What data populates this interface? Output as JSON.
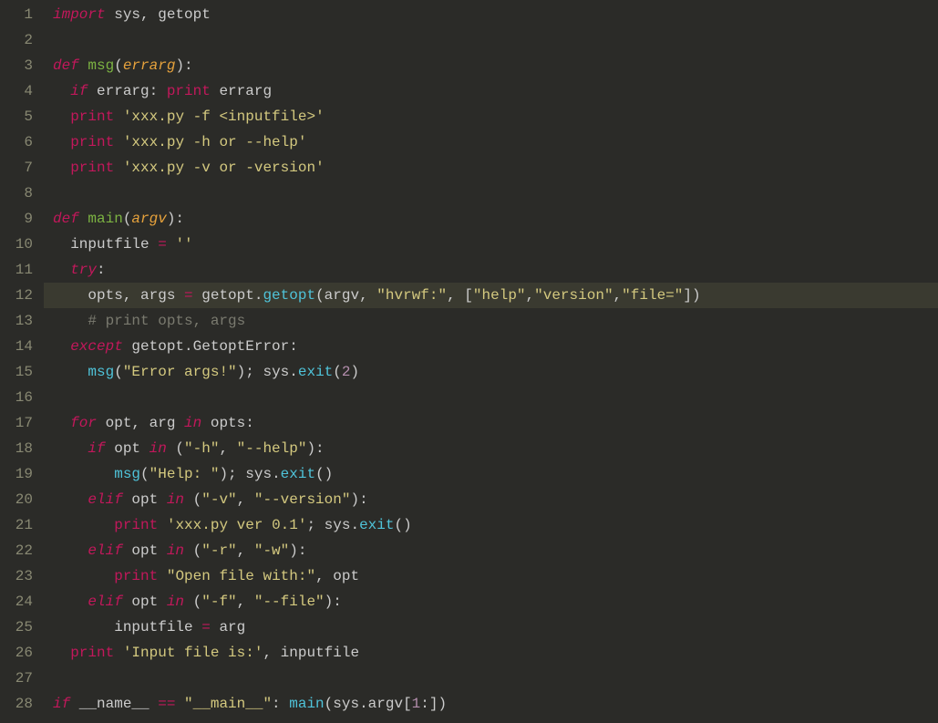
{
  "lines": [
    {
      "n": 1,
      "hl": false,
      "tokens": [
        [
          "kw",
          "import"
        ],
        [
          "pun",
          " sys"
        ],
        [
          "pun",
          ", getopt"
        ]
      ]
    },
    {
      "n": 2,
      "hl": false,
      "tokens": []
    },
    {
      "n": 3,
      "hl": false,
      "tokens": [
        [
          "kw",
          "def "
        ],
        [
          "fn",
          "msg"
        ],
        [
          "pun",
          "("
        ],
        [
          "prm",
          "errarg"
        ],
        [
          "pun",
          "):"
        ]
      ]
    },
    {
      "n": 4,
      "hl": false,
      "tokens": [
        [
          "pun",
          "  "
        ],
        [
          "kw",
          "if"
        ],
        [
          "pun",
          " errarg: "
        ],
        [
          "kw2",
          "print"
        ],
        [
          "pun",
          " errarg"
        ]
      ]
    },
    {
      "n": 5,
      "hl": false,
      "tokens": [
        [
          "pun",
          "  "
        ],
        [
          "kw2",
          "print"
        ],
        [
          "pun",
          " "
        ],
        [
          "str",
          "'xxx.py -f <inputfile>'"
        ]
      ]
    },
    {
      "n": 6,
      "hl": false,
      "tokens": [
        [
          "pun",
          "  "
        ],
        [
          "kw2",
          "print"
        ],
        [
          "pun",
          " "
        ],
        [
          "str",
          "'xxx.py -h or --help'"
        ]
      ]
    },
    {
      "n": 7,
      "hl": false,
      "tokens": [
        [
          "pun",
          "  "
        ],
        [
          "kw2",
          "print"
        ],
        [
          "pun",
          " "
        ],
        [
          "str",
          "'xxx.py -v or -version'"
        ]
      ]
    },
    {
      "n": 8,
      "hl": false,
      "tokens": []
    },
    {
      "n": 9,
      "hl": false,
      "tokens": [
        [
          "kw",
          "def "
        ],
        [
          "fn",
          "main"
        ],
        [
          "pun",
          "("
        ],
        [
          "prm",
          "argv"
        ],
        [
          "pun",
          "):"
        ]
      ]
    },
    {
      "n": 10,
      "hl": false,
      "tokens": [
        [
          "pun",
          "  inputfile "
        ],
        [
          "op",
          "="
        ],
        [
          "pun",
          " "
        ],
        [
          "str",
          "''"
        ]
      ]
    },
    {
      "n": 11,
      "hl": false,
      "tokens": [
        [
          "pun",
          "  "
        ],
        [
          "kw",
          "try"
        ],
        [
          "pun",
          ":"
        ]
      ]
    },
    {
      "n": 12,
      "hl": true,
      "tokens": [
        [
          "pun",
          "    opts, args "
        ],
        [
          "op",
          "="
        ],
        [
          "pun",
          " getopt."
        ],
        [
          "call",
          "getopt"
        ],
        [
          "pun",
          "(argv, "
        ],
        [
          "str",
          "\"hvrwf:\""
        ],
        [
          "pun",
          ", ["
        ],
        [
          "str",
          "\"help\""
        ],
        [
          "pun",
          ","
        ],
        [
          "str",
          "\"version\""
        ],
        [
          "pun",
          ","
        ],
        [
          "str",
          "\"file=\""
        ],
        [
          "pun",
          "])"
        ]
      ]
    },
    {
      "n": 13,
      "hl": false,
      "tokens": [
        [
          "pun",
          "    "
        ],
        [
          "cmt",
          "# print opts, args"
        ]
      ]
    },
    {
      "n": 14,
      "hl": false,
      "tokens": [
        [
          "pun",
          "  "
        ],
        [
          "kw",
          "except"
        ],
        [
          "pun",
          " getopt.GetoptError:"
        ]
      ]
    },
    {
      "n": 15,
      "hl": false,
      "tokens": [
        [
          "pun",
          "    "
        ],
        [
          "call",
          "msg"
        ],
        [
          "pun",
          "("
        ],
        [
          "str",
          "\"Error args!\""
        ],
        [
          "pun",
          "); sys."
        ],
        [
          "call",
          "exit"
        ],
        [
          "pun",
          "("
        ],
        [
          "num",
          "2"
        ],
        [
          "pun",
          ")"
        ]
      ]
    },
    {
      "n": 16,
      "hl": false,
      "tokens": []
    },
    {
      "n": 17,
      "hl": false,
      "tokens": [
        [
          "pun",
          "  "
        ],
        [
          "kw",
          "for"
        ],
        [
          "pun",
          " opt, arg "
        ],
        [
          "kw",
          "in"
        ],
        [
          "pun",
          " opts:"
        ]
      ]
    },
    {
      "n": 18,
      "hl": false,
      "tokens": [
        [
          "pun",
          "    "
        ],
        [
          "kw",
          "if"
        ],
        [
          "pun",
          " opt "
        ],
        [
          "kw",
          "in"
        ],
        [
          "pun",
          " ("
        ],
        [
          "str",
          "\"-h\""
        ],
        [
          "pun",
          ", "
        ],
        [
          "str",
          "\"--help\""
        ],
        [
          "pun",
          "):"
        ]
      ]
    },
    {
      "n": 19,
      "hl": false,
      "tokens": [
        [
          "pun",
          "       "
        ],
        [
          "call",
          "msg"
        ],
        [
          "pun",
          "("
        ],
        [
          "str",
          "\"Help: \""
        ],
        [
          "pun",
          "); sys."
        ],
        [
          "call",
          "exit"
        ],
        [
          "pun",
          "()"
        ]
      ]
    },
    {
      "n": 20,
      "hl": false,
      "tokens": [
        [
          "pun",
          "    "
        ],
        [
          "kw",
          "elif"
        ],
        [
          "pun",
          " opt "
        ],
        [
          "kw",
          "in"
        ],
        [
          "pun",
          " ("
        ],
        [
          "str",
          "\"-v\""
        ],
        [
          "pun",
          ", "
        ],
        [
          "str",
          "\"--version\""
        ],
        [
          "pun",
          "):"
        ]
      ]
    },
    {
      "n": 21,
      "hl": false,
      "tokens": [
        [
          "pun",
          "       "
        ],
        [
          "kw2",
          "print"
        ],
        [
          "pun",
          " "
        ],
        [
          "str",
          "'xxx.py ver 0.1'"
        ],
        [
          "pun",
          "; sys."
        ],
        [
          "call",
          "exit"
        ],
        [
          "pun",
          "()"
        ]
      ]
    },
    {
      "n": 22,
      "hl": false,
      "tokens": [
        [
          "pun",
          "    "
        ],
        [
          "kw",
          "elif"
        ],
        [
          "pun",
          " opt "
        ],
        [
          "kw",
          "in"
        ],
        [
          "pun",
          " ("
        ],
        [
          "str",
          "\"-r\""
        ],
        [
          "pun",
          ", "
        ],
        [
          "str",
          "\"-w\""
        ],
        [
          "pun",
          "):"
        ]
      ]
    },
    {
      "n": 23,
      "hl": false,
      "tokens": [
        [
          "pun",
          "       "
        ],
        [
          "kw2",
          "print"
        ],
        [
          "pun",
          " "
        ],
        [
          "str",
          "\"Open file with:\""
        ],
        [
          "pun",
          ", opt"
        ]
      ]
    },
    {
      "n": 24,
      "hl": false,
      "tokens": [
        [
          "pun",
          "    "
        ],
        [
          "kw",
          "elif"
        ],
        [
          "pun",
          " opt "
        ],
        [
          "kw",
          "in"
        ],
        [
          "pun",
          " ("
        ],
        [
          "str",
          "\"-f\""
        ],
        [
          "pun",
          ", "
        ],
        [
          "str",
          "\"--file\""
        ],
        [
          "pun",
          "):"
        ]
      ]
    },
    {
      "n": 25,
      "hl": false,
      "tokens": [
        [
          "pun",
          "       inputfile "
        ],
        [
          "op",
          "="
        ],
        [
          "pun",
          " arg"
        ]
      ]
    },
    {
      "n": 26,
      "hl": false,
      "tokens": [
        [
          "pun",
          "  "
        ],
        [
          "kw2",
          "print"
        ],
        [
          "pun",
          " "
        ],
        [
          "str",
          "'Input file is:'"
        ],
        [
          "pun",
          ", inputfile"
        ]
      ]
    },
    {
      "n": 27,
      "hl": false,
      "tokens": []
    },
    {
      "n": 28,
      "hl": false,
      "tokens": [
        [
          "kw",
          "if"
        ],
        [
          "pun",
          " __name__ "
        ],
        [
          "op",
          "=="
        ],
        [
          "pun",
          " "
        ],
        [
          "str",
          "\"__main__\""
        ],
        [
          "pun",
          ": "
        ],
        [
          "call",
          "main"
        ],
        [
          "pun",
          "(sys.argv["
        ],
        [
          "num",
          "1"
        ],
        [
          "pun",
          ":])"
        ]
      ]
    }
  ]
}
